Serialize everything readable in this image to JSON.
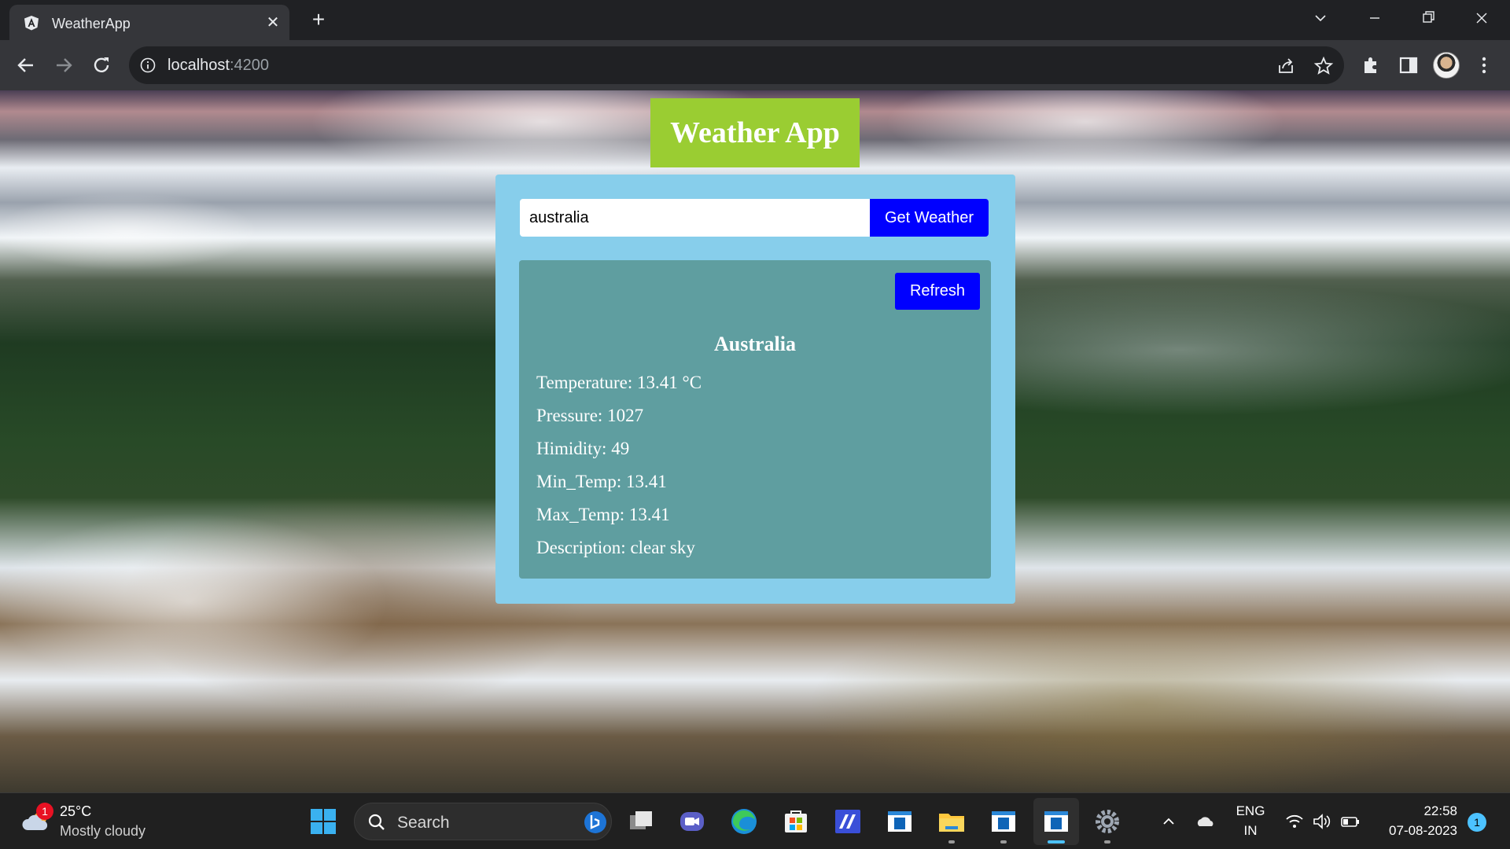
{
  "browser": {
    "tab_title": "WeatherApp",
    "url_host": "localhost",
    "url_port": ":4200"
  },
  "app": {
    "title": "Weather App",
    "search": {
      "value": "australia",
      "button_label": "Get Weather"
    },
    "result": {
      "refresh_label": "Refresh",
      "city": "Australia",
      "temperature": "Temperature: 13.41 °C",
      "pressure": "Pressure: 1027",
      "humidity": "Himidity: 49",
      "min_temp": "Min_Temp: 13.41",
      "max_temp": "Max_Temp: 13.41",
      "description": "Description: clear sky"
    },
    "colors": {
      "title_bg": "#9acd32",
      "card_bg": "#87ceeb",
      "result_bg": "#5f9ea0",
      "button_bg": "#0000ff"
    }
  },
  "taskbar": {
    "weather_badge": "1",
    "weather_temp": "25°C",
    "weather_condition": "Mostly cloudy",
    "search_label": "Search",
    "apps": [
      "start-icon",
      "task-view-icon",
      "teams-icon",
      "edge-icon",
      "store-icon",
      "vscode-icon",
      "app-window-icon",
      "file-explorer-icon",
      "app-window-icon",
      "app-window-icon",
      "settings-icon"
    ],
    "language": "ENG",
    "region": "IN",
    "time": "22:58",
    "date": "07-08-2023",
    "notification_count": "1"
  }
}
